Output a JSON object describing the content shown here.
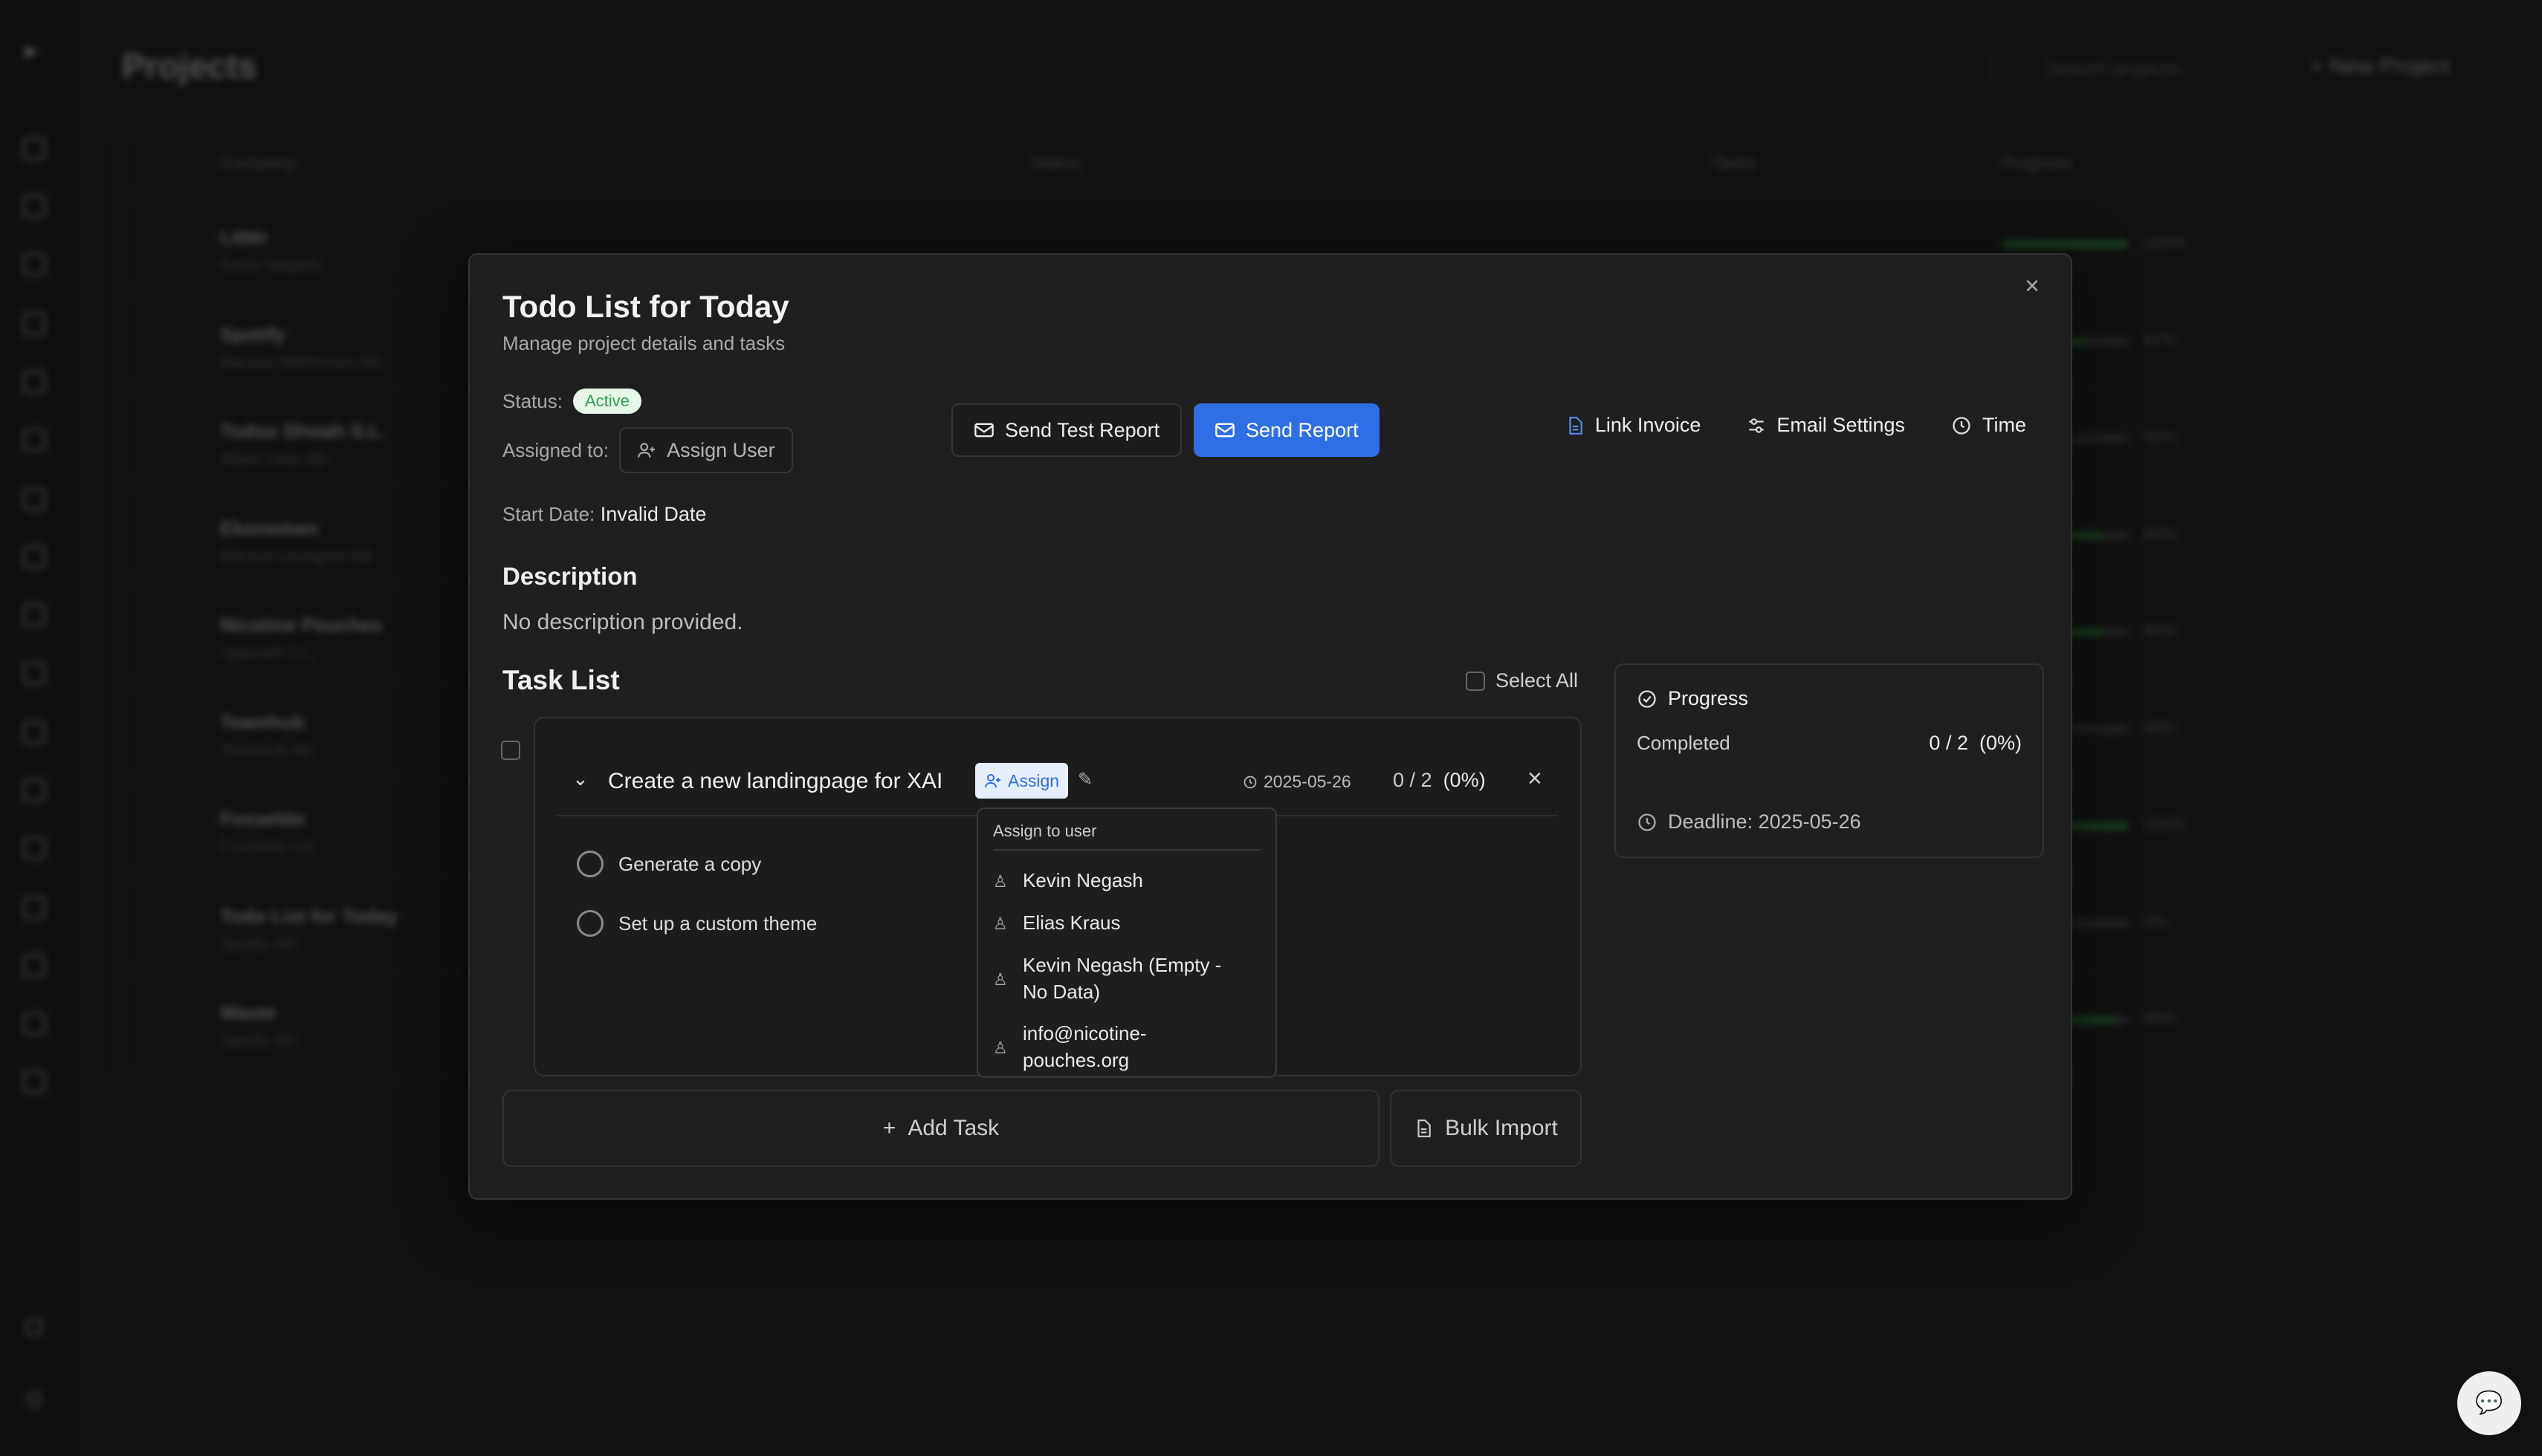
{
  "background": {
    "page_title": "Projects",
    "search_placeholder": "Search projects...",
    "new_project_label": "New Project",
    "columns": [
      "Company",
      "Status",
      "Tasks",
      "Progress"
    ],
    "rows": [
      {
        "name": "Littér",
        "sub": "Kevin Negash",
        "progress": 1.0,
        "pct": "100%"
      },
      {
        "name": "Spotify",
        "sub": "Marcus Wahlström AB",
        "progress": 0.67,
        "pct": "67%"
      },
      {
        "name": "Todoo Shwah S.L.",
        "sub": "Albert Ortiz AB",
        "progress": 0.5,
        "pct": "50%"
      },
      {
        "name": "Ekonomen",
        "sub": "Marcus Lovegren AB",
        "progress": 0.8,
        "pct": "80%"
      },
      {
        "name": "Nicotine Pouches",
        "sub": "Uptowell S.L.",
        "progress": 0.8,
        "pct": "80%"
      },
      {
        "name": "Teamhub",
        "sub": "Teamhub AB",
        "progress": 0.5,
        "pct": "46%"
      },
      {
        "name": "Fosseldo",
        "sub": "Fosseldo Ltd.",
        "progress": 1.0,
        "pct": "100%"
      },
      {
        "name": "Todo List for Today",
        "sub": "Spotify AB",
        "progress": 0.0,
        "pct": "0%"
      },
      {
        "name": "Waste",
        "sub": "Spotify AB",
        "progress": 0.9,
        "pct": "90%"
      }
    ]
  },
  "modal": {
    "title": "Todo List for Today",
    "subtitle": "Manage project details and tasks",
    "status_label": "Status:",
    "status_value": "Active",
    "assigned_label": "Assigned to:",
    "assign_user_label": "Assign User",
    "send_test_report_label": "Send Test Report",
    "send_report_label": "Send Report",
    "link_invoice_label": "Link Invoice",
    "email_settings_label": "Email Settings",
    "time_label": "Time",
    "start_date_label": "Start Date:",
    "start_date_value": "Invalid Date",
    "description_heading": "Description",
    "description_text": "No description provided.",
    "task_list_heading": "Task List",
    "select_all_label": "Select All",
    "task": {
      "name": "Create a new landingpage for XAI",
      "assign_label": "Assign",
      "date": "2025-05-26",
      "count": "0 / 2",
      "percent": "(0%)",
      "subtasks": [
        "Generate a copy",
        "Set up a custom theme"
      ]
    },
    "assign_dropdown": {
      "header": "Assign to user",
      "users": [
        "Kevin Negash",
        "Elias Kraus",
        "Kevin Negash (Empty - No Data)",
        "info@nicotine-pouches.org"
      ]
    },
    "progress_panel": {
      "title": "Progress",
      "completed_label": "Completed",
      "completed_value": "0 / 2",
      "completed_percent": "(0%)",
      "deadline": "Deadline: 2025-05-26"
    },
    "add_task_label": "Add Task",
    "bulk_import_label": "Bulk Import"
  },
  "colors": {
    "accent": "#2f6fe6",
    "status_active_bg": "#e6f6e9",
    "status_active_text": "#2f9e4f"
  }
}
